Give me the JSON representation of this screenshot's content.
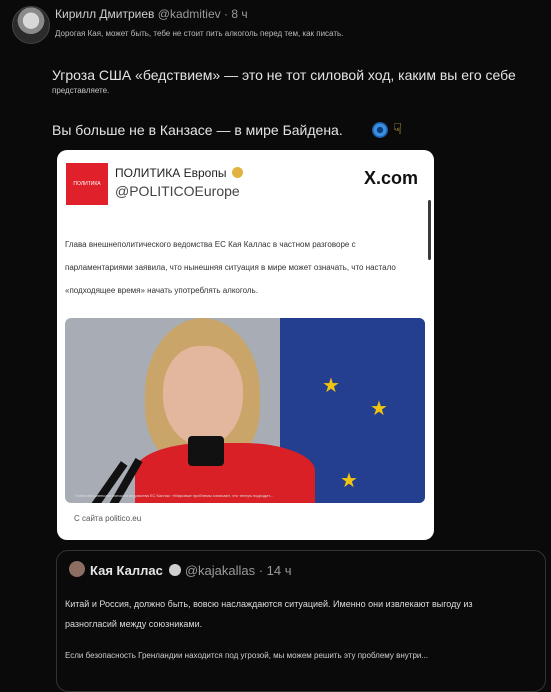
{
  "post": {
    "author": "Кирилл Дмитриев",
    "handle": "@kadmitiev",
    "time": "· 8 ч",
    "subtitle": "Дорогая Кая, может быть, тебе не стоит пить алкоголь перед тем, как писать.",
    "paragraph1": "Угроза США «бедствием» — это не тот силовой ход, каким вы его себе",
    "paragraph1_cont": "представляете.",
    "paragraph2": "Вы больше не в Канзасе — в мире Байдена."
  },
  "embed": {
    "logo_text": "ПОЛИТИКА",
    "account_name": "ПОЛИТИКА Европы",
    "account_handle": "@POLITICOEurope",
    "site": "X.com",
    "body": "Глава внешнеполитического ведомства ЕС Кая Каллас в частном разговоре с парламентариями заявила, что нынешняя ситуация в мире может означать, что настало «подходящее время» начать употреблять алкоголь.",
    "image_caption": "Глава внешнеполитического ведомства ЕС Каллас: «Мировые проблемы означают, что теперь подходит...",
    "source": "С сайта politico.eu"
  },
  "quote": {
    "name": "Кая Каллас",
    "handle": "@kajakallas · 14 ч",
    "text1": "Китай и Россия, должно быть, вовсю наслаждаются ситуацией. Именно они извлекают выгоду из разногласий между союзниками.",
    "text2": "Если безопасность Гренландии находится под угрозой, мы можем решить эту проблему внутри..."
  },
  "icons": [
    "avatar",
    "globe-emoji-icon",
    "pointing-hand-emoji-icon",
    "verified-badge-icon",
    "star-icon"
  ]
}
